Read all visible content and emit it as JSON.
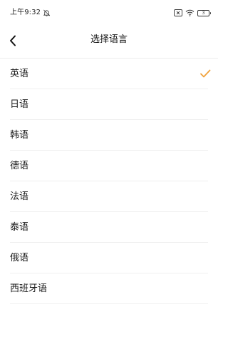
{
  "status_bar": {
    "time": "上午9:32",
    "battery_level": "3"
  },
  "header": {
    "title": "选择语言",
    "back_icon": "chevron-left-icon"
  },
  "languages": [
    {
      "label": "英语",
      "selected": true
    },
    {
      "label": "日语",
      "selected": false
    },
    {
      "label": "韩语",
      "selected": false
    },
    {
      "label": "德语",
      "selected": false
    },
    {
      "label": "法语",
      "selected": false
    },
    {
      "label": "泰语",
      "selected": false
    },
    {
      "label": "俄语",
      "selected": false
    },
    {
      "label": "西班牙语",
      "selected": false
    }
  ],
  "colors": {
    "accent": "#f0a13a",
    "text": "#1a1a1a",
    "divider": "#efefef"
  }
}
